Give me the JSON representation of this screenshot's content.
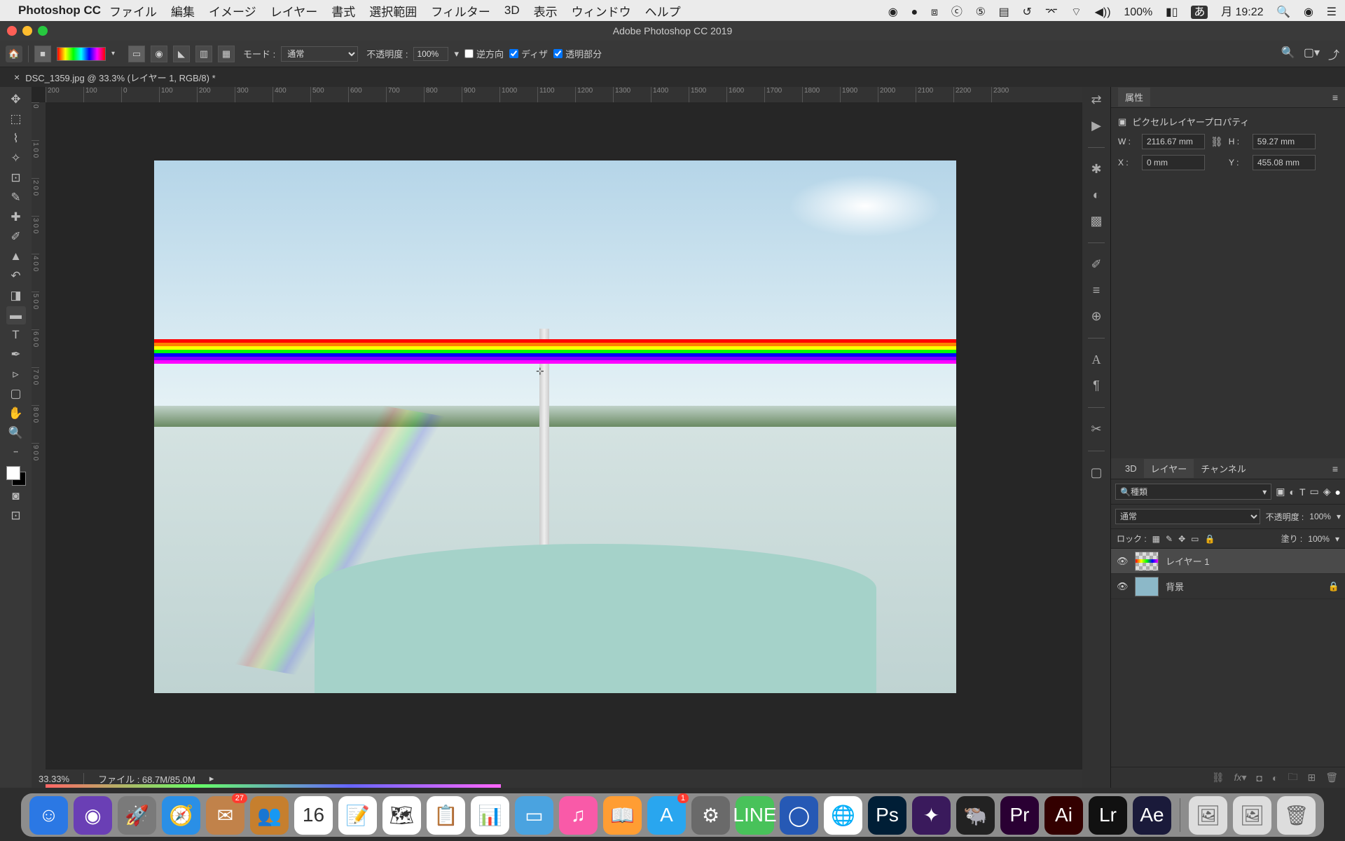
{
  "menubar": {
    "app": "Photoshop CC",
    "items": [
      "ファイル",
      "編集",
      "イメージ",
      "レイヤー",
      "書式",
      "選択範囲",
      "フィルター",
      "3D",
      "表示",
      "ウィンドウ",
      "ヘルプ"
    ],
    "battery": "100%",
    "clock": "月 19:22"
  },
  "window": {
    "title": "Adobe Photoshop CC 2019"
  },
  "options": {
    "mode_lbl": "モード :",
    "mode_val": "通常",
    "opacity_lbl": "不透明度 :",
    "opacity_val": "100%",
    "reverse": "逆方向",
    "dither": "ディザ",
    "transparent": "透明部分"
  },
  "doc_tab": {
    "close": "×",
    "title": "DSC_1359.jpg @ 33.3% (レイヤー 1, RGB/8) *"
  },
  "ruler_h": [
    "200",
    "100",
    "0",
    "100",
    "200",
    "300",
    "400",
    "500",
    "600",
    "700",
    "800",
    "900",
    "1000",
    "1100",
    "1200",
    "1300",
    "1400",
    "1500",
    "1600",
    "1700",
    "1800",
    "1900",
    "2000",
    "2100",
    "2200",
    "2300"
  ],
  "ruler_v": [
    "0",
    "1 0 0",
    "2 0 0",
    "3 0 0",
    "4 0 0",
    "5 0 0",
    "6 0 0",
    "7 0 0",
    "8 0 0",
    "9 0 0"
  ],
  "status": {
    "zoom": "33.33%",
    "file": "ファイル : 68.7M/85.0M"
  },
  "prop_panel": {
    "title": "属性",
    "subtitle": "ピクセルレイヤープロパティ",
    "w_lbl": "W :",
    "w_val": "2116.67 mm",
    "h_lbl": "H :",
    "h_val": "59.27 mm",
    "x_lbl": "X :",
    "x_val": "0 mm",
    "y_lbl": "Y :",
    "y_val": "455.08 mm"
  },
  "layers_panel": {
    "tabs": [
      "3D",
      "レイヤー",
      "チャンネル"
    ],
    "kind": "種類",
    "blend": "通常",
    "opacity_lbl": "不透明度 :",
    "opacity_val": "100%",
    "lock_lbl": "ロック :",
    "fill_lbl": "塗り :",
    "fill_val": "100%",
    "layers": [
      {
        "name": "レイヤー 1",
        "locked": false
      },
      {
        "name": "背景",
        "locked": true
      }
    ]
  },
  "dock_icons": [
    {
      "c": "#2b78e4",
      "g": "☺"
    },
    {
      "c": "#6a3fb5",
      "g": "◉"
    },
    {
      "c": "#7a7a7a",
      "g": "🚀"
    },
    {
      "c": "#2a8fe6",
      "g": "🧭"
    },
    {
      "c": "#c1824a",
      "g": "✉",
      "b": "27"
    },
    {
      "c": "#c67f2e",
      "g": "👥"
    },
    {
      "c": "#fff",
      "g": "16"
    },
    {
      "c": "#fff",
      "g": "📝"
    },
    {
      "c": "#fff",
      "g": "🗺"
    },
    {
      "c": "#fff",
      "g": "📋"
    },
    {
      "c": "#fff",
      "g": "📊"
    },
    {
      "c": "#4aa3e0",
      "g": "▭"
    },
    {
      "c": "#f95aa8",
      "g": "♫"
    },
    {
      "c": "#ff9d33",
      "g": "📖"
    },
    {
      "c": "#29a6ef",
      "g": "A",
      "b": "1"
    },
    {
      "c": "#6a6a6a",
      "g": "⚙"
    },
    {
      "c": "#48c25a",
      "g": "LINE"
    },
    {
      "c": "#2659b5",
      "g": "◯"
    },
    {
      "c": "#fff",
      "g": "🌐"
    },
    {
      "c": "#001e36",
      "g": "Ps"
    },
    {
      "c": "#3a1a5c",
      "g": "✦"
    },
    {
      "c": "#222",
      "g": "🐃"
    },
    {
      "c": "#2a0033",
      "g": "Pr"
    },
    {
      "c": "#330000",
      "g": "Ai"
    },
    {
      "c": "#111",
      "g": "Lr"
    },
    {
      "c": "#1a1a3a",
      "g": "Ae"
    }
  ]
}
